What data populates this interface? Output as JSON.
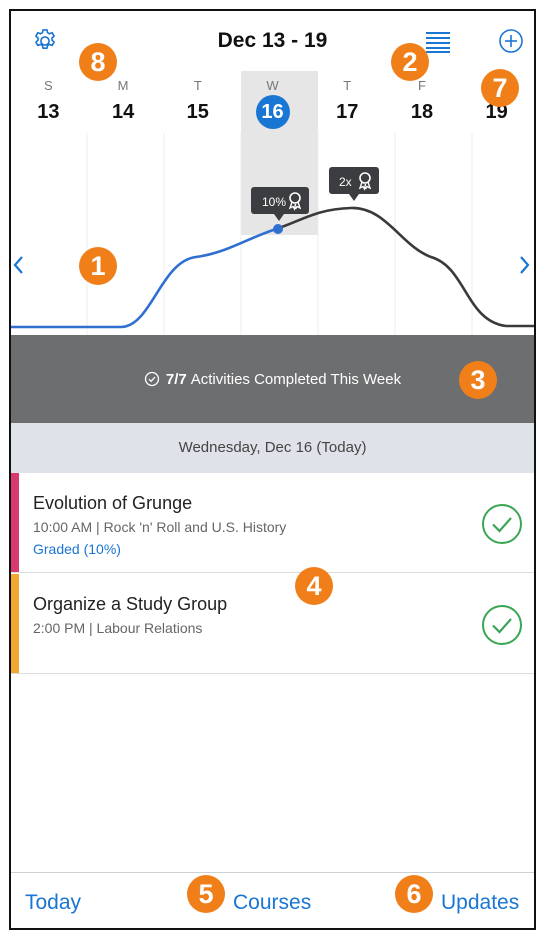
{
  "header": {
    "title": "Dec 13 - 19"
  },
  "week": {
    "days": [
      {
        "dow": "S",
        "num": "13"
      },
      {
        "dow": "M",
        "num": "14"
      },
      {
        "dow": "T",
        "num": "15"
      },
      {
        "dow": "W",
        "num": "16"
      },
      {
        "dow": "T",
        "num": "17"
      },
      {
        "dow": "F",
        "num": "18"
      },
      {
        "dow": "S",
        "num": "19"
      }
    ],
    "selected_index": 3
  },
  "chart": {
    "badge_percent": "10%",
    "badge_multiplier": "2x",
    "line_color_progress": "#2f6fd0",
    "line_color_future": "#3a3a3a"
  },
  "banner": {
    "count": "7/7",
    "text": "Activities Completed This Week"
  },
  "date_header": "Wednesday, Dec 16 (Today)",
  "activities": [
    {
      "title": "Evolution of Grunge",
      "subtitle": "10:00 AM | Rock 'n' Roll and U.S. History",
      "graded": "Graded (10%)",
      "color": "#d83a6f"
    },
    {
      "title": "Organize a Study Group",
      "subtitle": "2:00 PM | Labour Relations",
      "graded": "",
      "color": "#f0a830"
    }
  ],
  "tabs": {
    "today": "Today",
    "courses": "Courses",
    "updates": "Updates"
  },
  "callouts": {
    "c1": "1",
    "c2": "2",
    "c3": "3",
    "c4": "4",
    "c5": "5",
    "c6": "6",
    "c7": "7",
    "c8": "8"
  },
  "colors": {
    "accent": "#1976d2",
    "callout": "#f07f1a",
    "banner_bg": "#6d6e70",
    "complete_green": "#3aa655"
  }
}
